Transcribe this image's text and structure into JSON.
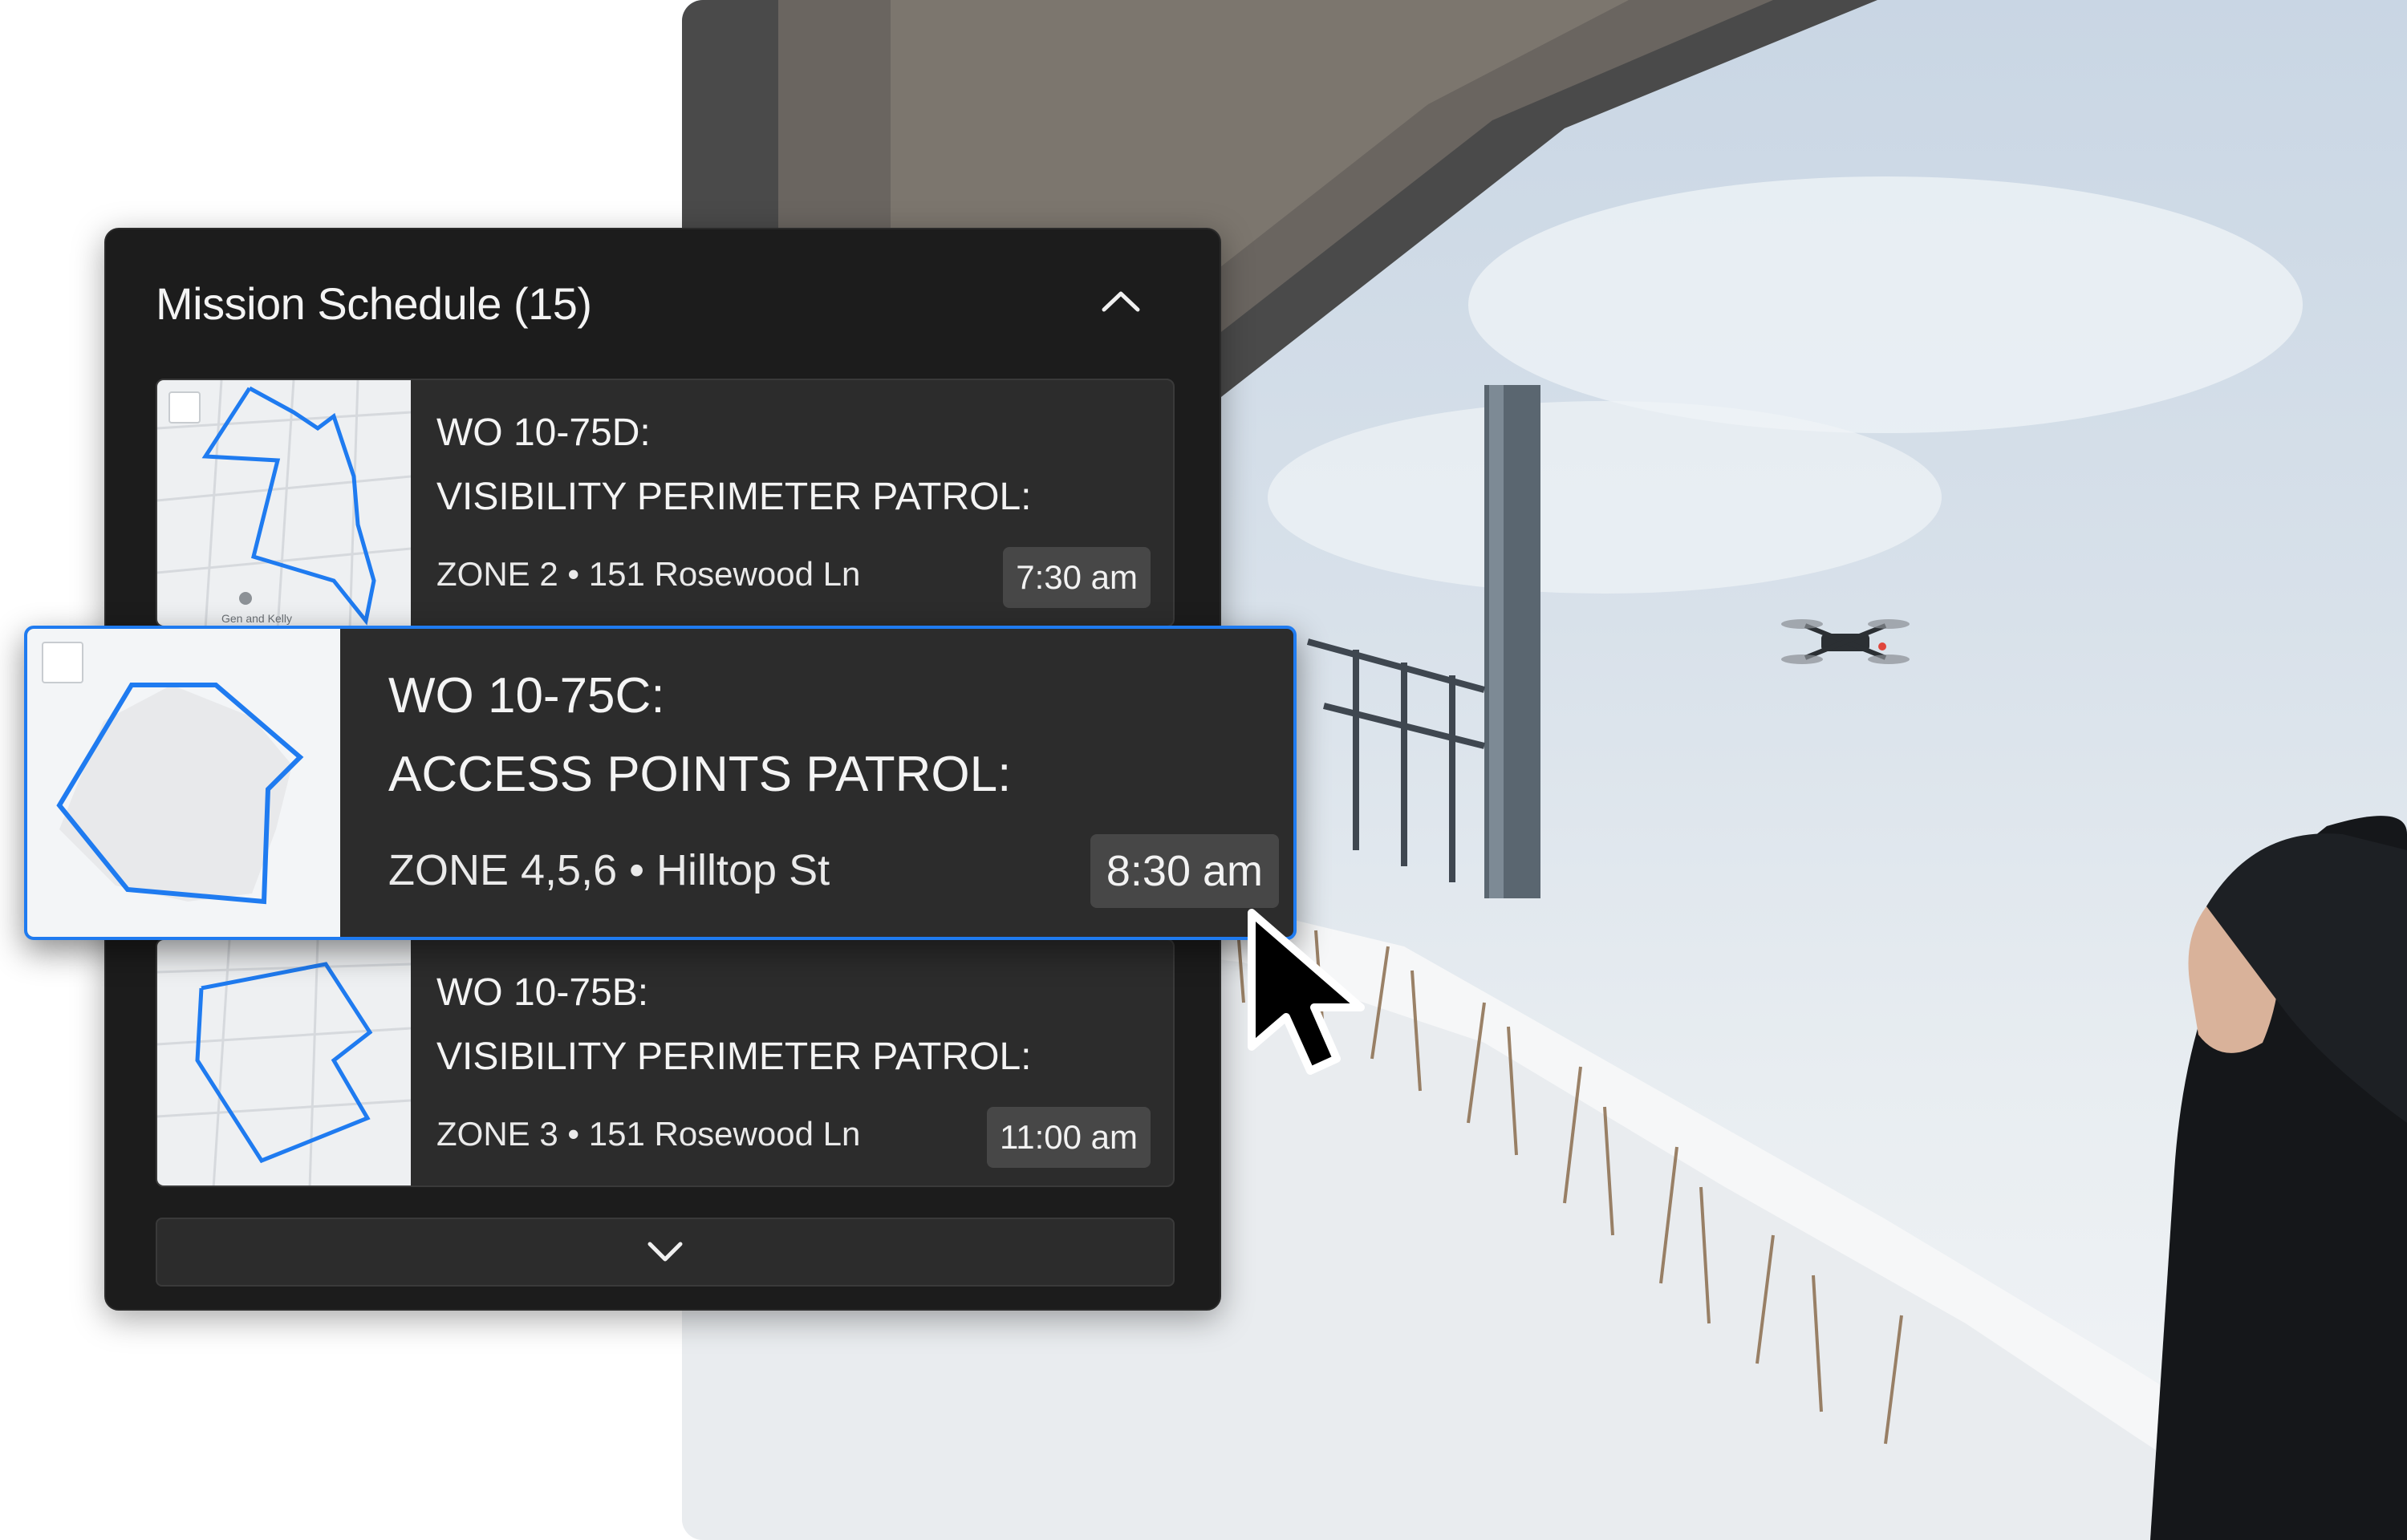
{
  "panel": {
    "title": "Mission Schedule (15)",
    "collapse_icon": "chevron-up-icon",
    "expand_icon": "chevron-down-icon"
  },
  "missions": [
    {
      "wo": "WO 10-75D:",
      "title": "VISIBILITY PERIMETER PATROL:",
      "zone": "ZONE 2 • 151 Rosewood Ln",
      "time": "7:30 am",
      "map_labels": [
        "Gen and Kelly"
      ]
    },
    {
      "wo": "WO 10-75C:",
      "title": "ACCESS POINTS PATROL:",
      "zone": "ZONE 4,5,6 • Hilltop St",
      "time": "8:30 am",
      "selected": true
    },
    {
      "wo": "WO 10-75B:",
      "title": "VISIBILITY PERIMETER PATROL:",
      "zone": "ZONE 3 • 151 Rosewood Ln",
      "time": "11:00 am"
    }
  ],
  "colors": {
    "panel_bg": "#1c1c1c",
    "card_bg": "#2c2c2c",
    "accent": "#1f7bf0",
    "time_badge_bg": "#474747"
  },
  "background": {
    "description_icon": "drone-photo",
    "cursor_icon": "mouse-pointer-icon"
  }
}
